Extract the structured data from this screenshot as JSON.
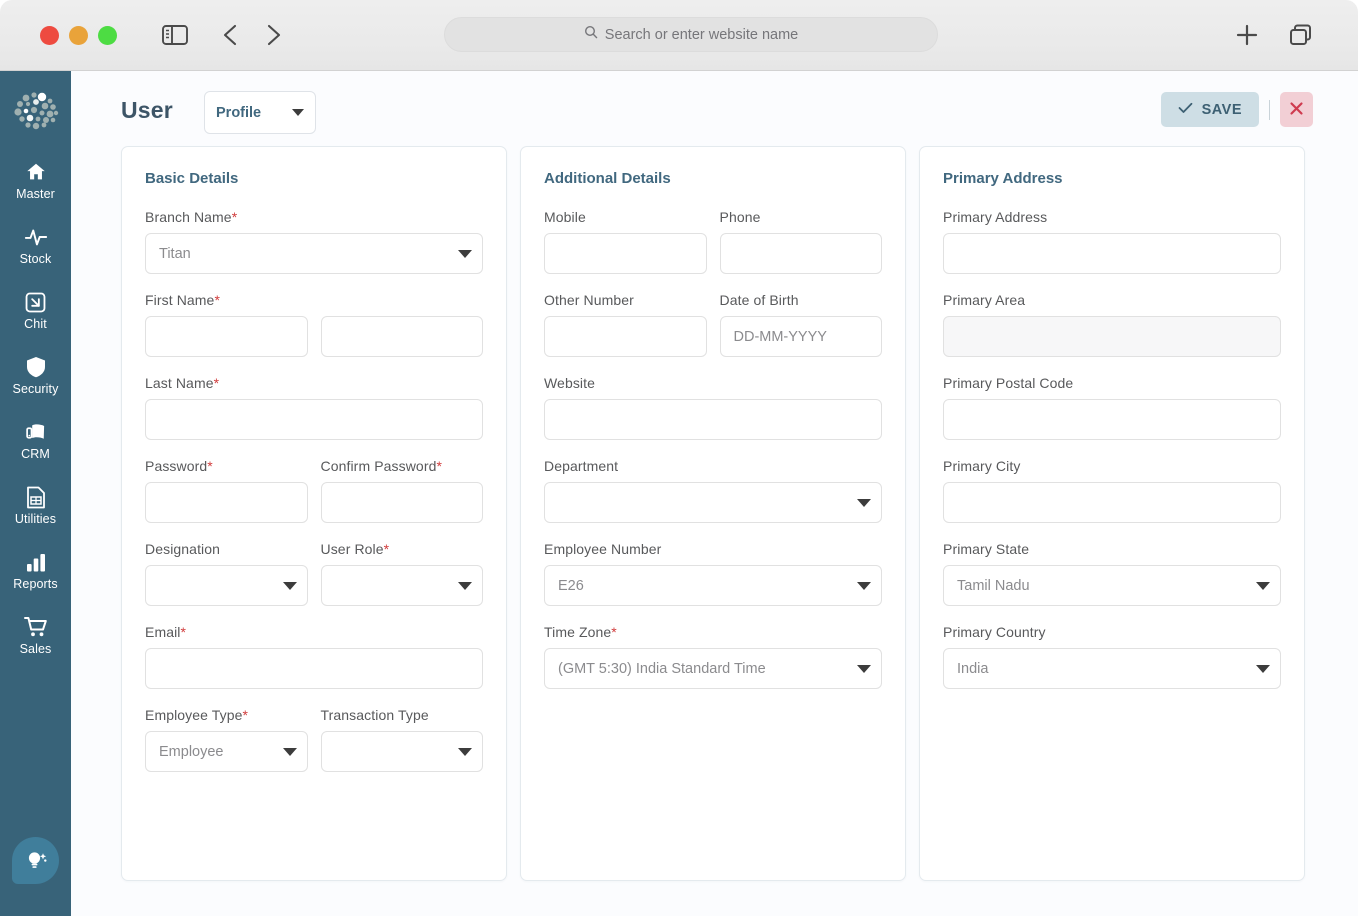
{
  "browser": {
    "search": {
      "placeholder": "Search or enter website name",
      "icon": "search-icon"
    },
    "traffic": [
      "close",
      "minimize",
      "maximize"
    ],
    "icons": {
      "sidebar_toggle": "sidebar-toggle-icon",
      "back": "chevron-left-icon",
      "forward": "chevron-right-icon",
      "new_tab": "plus-icon",
      "tab_overview": "tab-overview-icon"
    }
  },
  "sidebar": {
    "logo": "dot-cluster-logo",
    "fab_icon": "lightbulb-idea-icon",
    "items": [
      {
        "label": "Master",
        "icon": "home-icon"
      },
      {
        "label": "Stock",
        "icon": "pulse-icon"
      },
      {
        "label": "Chit",
        "icon": "resize-frame-icon"
      },
      {
        "label": "Security",
        "icon": "shield-icon"
      },
      {
        "label": "CRM",
        "icon": "crm-icon"
      },
      {
        "label": "Utilities",
        "icon": "document-grid-icon"
      },
      {
        "label": "Reports",
        "icon": "bar-chart-icon"
      },
      {
        "label": "Sales",
        "icon": "shopping-cart-icon"
      }
    ]
  },
  "header": {
    "title": "User",
    "profile_select": {
      "value": "Profile",
      "icon": "chevron-down-icon"
    },
    "save_label": "SAVE",
    "save_icon": "check-icon",
    "close_icon": "close-x-icon"
  },
  "panels": [
    {
      "title": "Basic Details",
      "fields": [
        {
          "label": "Branch Name",
          "required": true,
          "type": "select",
          "value": "Titan"
        },
        {
          "label": "First Name",
          "required": true,
          "type": "split",
          "value": "",
          "value2": ""
        },
        {
          "label": "Last Name",
          "required": true,
          "type": "text",
          "value": ""
        },
        {
          "label": "Password",
          "required": true,
          "type": "pair",
          "value": "",
          "label2": "Confirm Password",
          "required2": true,
          "type2": "text",
          "value2": ""
        },
        {
          "label": "Designation",
          "required": false,
          "type": "pair-select",
          "value": "",
          "label2": "User Role",
          "required2": true,
          "type2": "select",
          "value2": ""
        },
        {
          "label": "Email",
          "required": true,
          "type": "text",
          "value": ""
        },
        {
          "label": "Employee Type",
          "required": true,
          "type": "pair-select",
          "value": "Employee",
          "label2": "Transaction Type",
          "required2": false,
          "type2": "select",
          "value2": ""
        }
      ]
    },
    {
      "title": "Additional Details",
      "fields": [
        {
          "label": "Mobile",
          "required": false,
          "type": "pair",
          "value": "",
          "label2": "Phone",
          "required2": false,
          "type2": "text",
          "value2": ""
        },
        {
          "label": "Other Number",
          "required": false,
          "type": "pair",
          "value": "",
          "label2": "Date of Birth",
          "required2": false,
          "type2": "text",
          "value2": "",
          "placeholder2": "DD-MM-YYYY"
        },
        {
          "label": "Website",
          "required": false,
          "type": "text",
          "value": ""
        },
        {
          "label": "Department",
          "required": false,
          "type": "select",
          "value": ""
        },
        {
          "label": "Employee Number",
          "required": false,
          "type": "select",
          "value": "E26"
        },
        {
          "label": "Time Zone",
          "required": true,
          "type": "select",
          "value": "(GMT 5:30) India Standard Time"
        }
      ]
    },
    {
      "title": "Primary Address",
      "fields": [
        {
          "label": "Primary Address",
          "required": false,
          "type": "text",
          "value": ""
        },
        {
          "label": "Primary Area",
          "required": false,
          "type": "text",
          "value": "",
          "tinted": true
        },
        {
          "label": "Primary Postal Code",
          "required": false,
          "type": "text",
          "value": ""
        },
        {
          "label": "Primary City",
          "required": false,
          "type": "text",
          "value": ""
        },
        {
          "label": "Primary State",
          "required": false,
          "type": "select",
          "value": "Tamil Nadu"
        },
        {
          "label": "Primary Country",
          "required": false,
          "type": "select",
          "value": "India"
        }
      ]
    }
  ],
  "colors": {
    "rail": "#386379",
    "accent": "#41687f",
    "required": "#d13c3c",
    "save_bg": "#cedee5",
    "close_bg": "#f2cfd5",
    "close_fg": "#cf3b4f",
    "page_bg": "#fbfcfe"
  }
}
